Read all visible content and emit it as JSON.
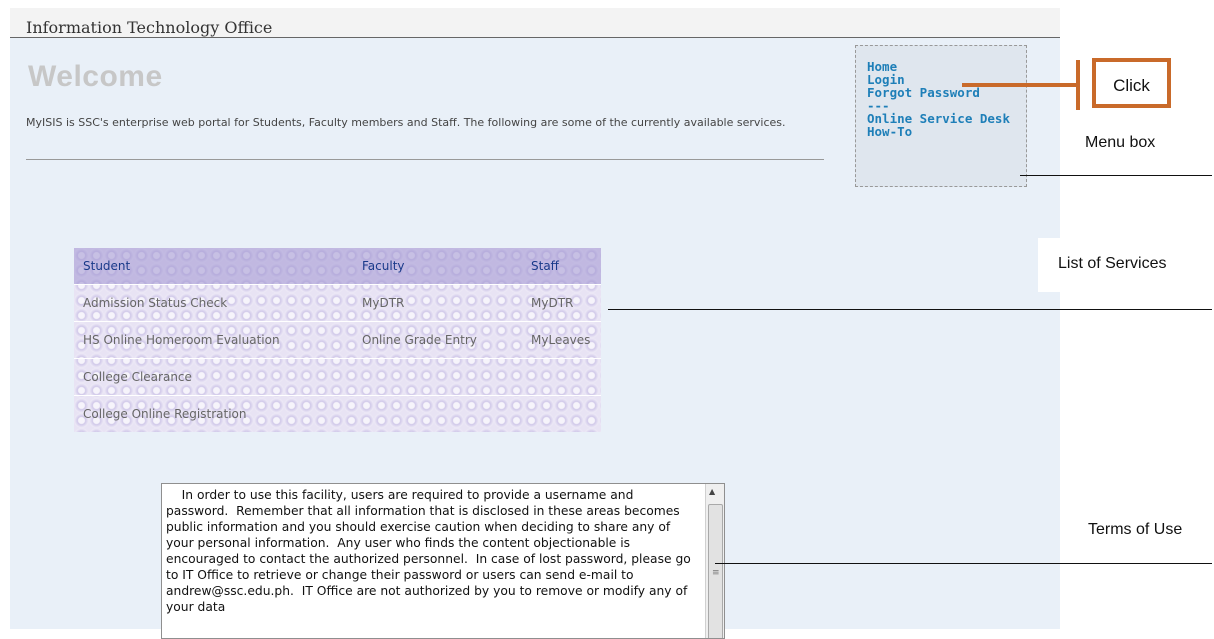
{
  "header": {
    "title": "Information Technology Office"
  },
  "welcome": {
    "heading": "Welcome",
    "intro": "MyISIS is SSC's enterprise web portal for Students, Faculty members and Staff. The following are some of the currently available services."
  },
  "menu": {
    "items": [
      {
        "label": "Home"
      },
      {
        "label": "Login"
      },
      {
        "label": "Forgot Password"
      },
      {
        "label": "---"
      },
      {
        "label": "Online Service Desk"
      },
      {
        "label": "How-To"
      }
    ]
  },
  "services": {
    "headers": [
      "Student",
      "Faculty",
      "Staff"
    ],
    "rows": [
      [
        "Admission Status Check",
        "MyDTR",
        "MyDTR"
      ],
      [
        "HS Online Homeroom Evaluation",
        "Online Grade Entry",
        "MyLeaves"
      ],
      [
        "College Clearance",
        "",
        ""
      ],
      [
        "College Online Registration",
        "",
        ""
      ]
    ]
  },
  "terms": {
    "text": "    In order to use this facility, users are required to provide a username and password.  Remember that all information that is disclosed in these areas becomes public information and you should exercise caution when deciding to share any of your personal information.  Any user who finds the content objectionable is encouraged to contact the authorized personnel.  In case of lost password, please go to IT Office to retrieve or change their password or users can send e-mail to andrew@ssc.edu.ph.  IT Office are not authorized by you to remove or modify any of your data"
  },
  "annotations": {
    "click": "Click",
    "menu_box": "Menu box",
    "list_of_services": "List of Services",
    "terms_of_use": "Terms of Use"
  },
  "colors": {
    "accent": "#c96a2a",
    "link": "#1e7fb8",
    "page_bg": "#e9f0f8"
  }
}
